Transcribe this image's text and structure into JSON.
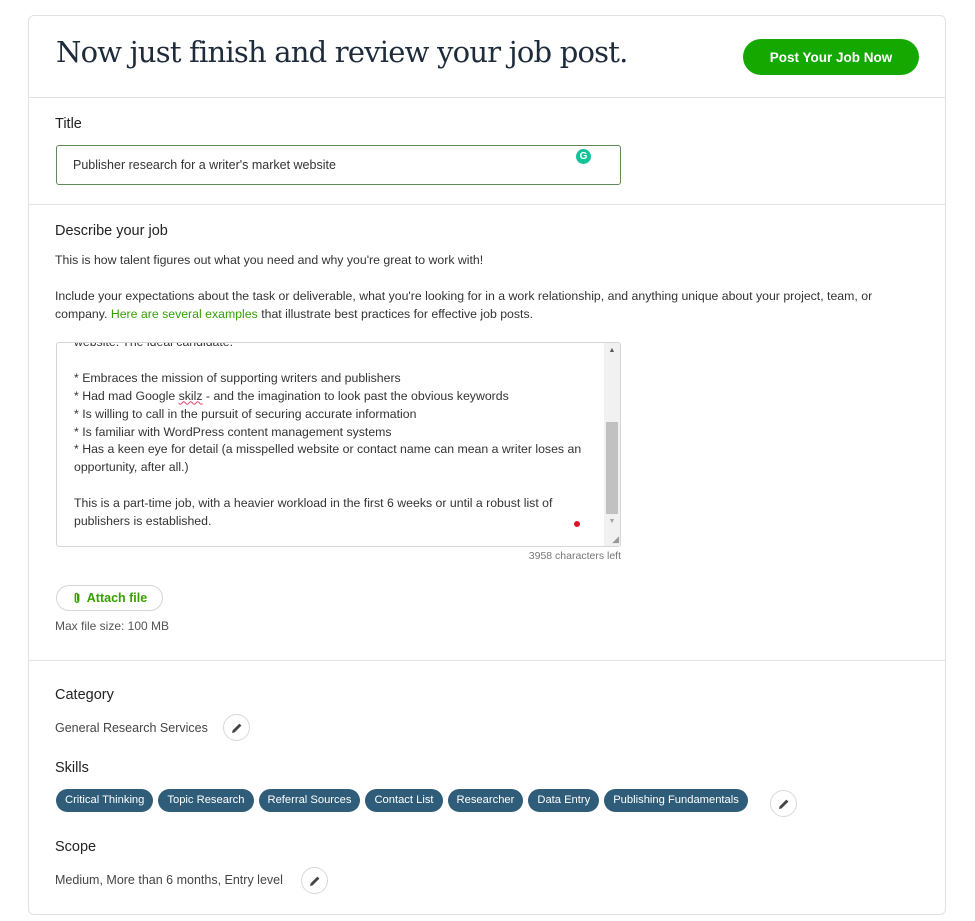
{
  "header": {
    "title": "Now just finish and review your job post.",
    "post_button": "Post Your Job Now"
  },
  "title_section": {
    "label": "Title",
    "value": "Publisher research for a writer's market website",
    "grammarly_icon": "grammarly-icon"
  },
  "description_section": {
    "label": "Describe your job",
    "help_line_1": "This is how talent figures out what you need and why you're great to work with!",
    "help_line_2_before": "Include your expectations about the task or deliverable, what you're looking for in a work relationship, and anything unique about your project, team, or company.",
    "help_link": "Here are several examples",
    "help_line_2_after": "that illustrate best practices for effective job posts.",
    "text_lines": [
      "website. The ideal candidate:",
      "",
      "* Embraces the mission of supporting writers and publishers",
      "* Had mad Google ",
      "skilz",
      " - and the imagination to look past the obvious keywords",
      "* Is willing to call in the pursuit of securing accurate information",
      "* Is familiar with WordPress content management systems",
      "* Has a keen eye for detail (a misspelled website or contact name can mean a writer loses an opportunity, after all.)",
      "",
      "This is a part-time job, with a heavier workload in the first 6 weeks or until a robust list of publishers is established."
    ],
    "chars_left": "3958 characters left",
    "attach_button": "Attach file",
    "max_file_size": "Max file size: 100 MB"
  },
  "category": {
    "label": "Category",
    "value": "General Research Services"
  },
  "skills": {
    "label": "Skills",
    "items": [
      "Critical Thinking",
      "Topic Research",
      "Referral Sources",
      "Contact List",
      "Researcher",
      "Data Entry",
      "Publishing Fundamentals"
    ]
  },
  "scope": {
    "label": "Scope",
    "value": "Medium, More than 6 months, Entry level"
  },
  "colors": {
    "brand_green": "#14a800",
    "link_green": "#37a000",
    "skill_chip": "#2f5d79",
    "title_text": "#1d2b3a"
  }
}
